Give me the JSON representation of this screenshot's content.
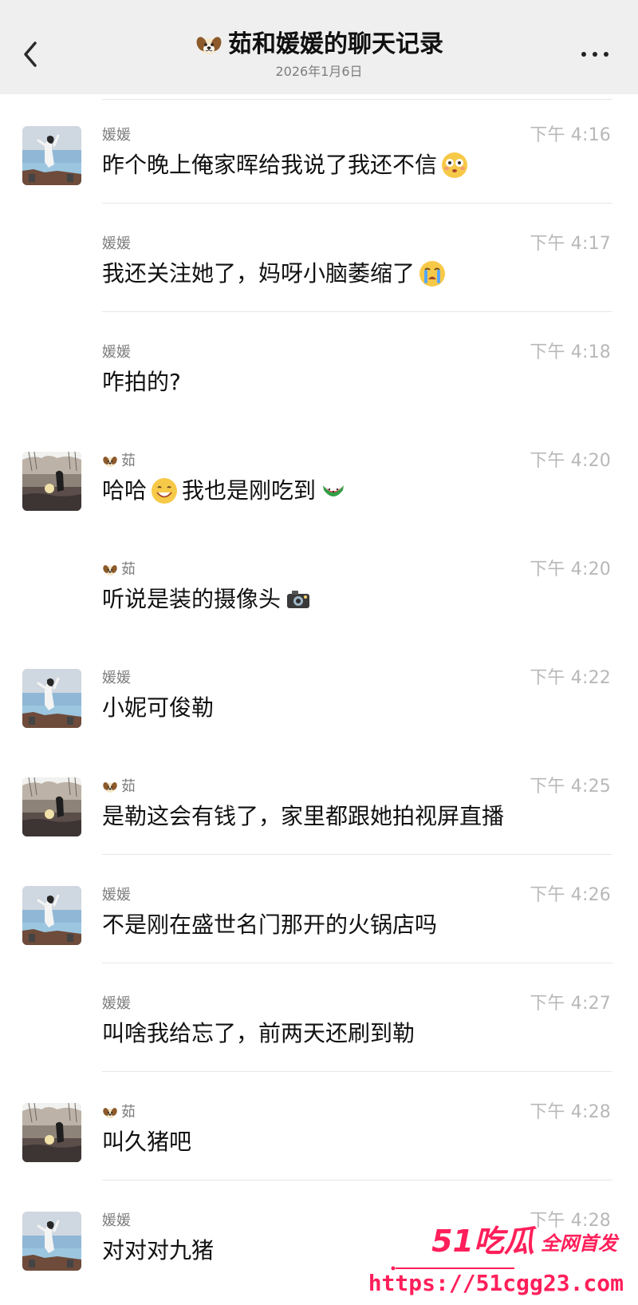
{
  "header": {
    "title": "茹和媛媛的聊天记录",
    "date": "2026年1月6日",
    "title_icon": "dog-face-icon",
    "back_icon": "chevron-left-icon",
    "more_icon": "more-horizontal-icon"
  },
  "messages": [
    {
      "sender": "媛媛",
      "time": "下午 4:16",
      "text": "昨个晚上俺家晖给我说了我还不信",
      "emoji": "flushed-face-icon",
      "show_avatar": true,
      "avatar_style": "girl"
    },
    {
      "sender": "媛媛",
      "time": "下午 4:17",
      "text": "我还关注她了，妈呀小脑萎缩了",
      "emoji": "crying-face-icon",
      "show_avatar": false,
      "avatar_style": "girl"
    },
    {
      "sender": "媛媛",
      "time": "下午 4:18",
      "text": "咋拍的?",
      "emoji": "",
      "show_avatar": false,
      "avatar_style": "girl"
    },
    {
      "sender": "茹",
      "time": "下午 4:20",
      "text_before": "哈哈",
      "text_after": "我也是刚吃到",
      "emoji_before": "grinning-face-icon",
      "emoji_after": "watermelon-icon",
      "show_avatar": true,
      "avatar_style": "sunset"
    },
    {
      "sender": "茹",
      "time": "下午 4:20",
      "text": "听说是装的摄像头",
      "emoji": "camera-icon",
      "show_avatar": false,
      "avatar_style": "sunset"
    },
    {
      "sender": "媛媛",
      "time": "下午 4:22",
      "text": "小妮可俊勒",
      "emoji": "",
      "show_avatar": true,
      "avatar_style": "girl"
    },
    {
      "sender": "茹",
      "time": "下午 4:25",
      "text": "是勒这会有钱了，家里都跟她拍视屏直播",
      "emoji": "",
      "show_avatar": true,
      "avatar_style": "sunset"
    },
    {
      "sender": "媛媛",
      "time": "下午 4:26",
      "text": "不是刚在盛世名门那开的火锅店吗",
      "emoji": "",
      "show_avatar": true,
      "avatar_style": "girl"
    },
    {
      "sender": "媛媛",
      "time": "下午 4:27",
      "text": "叫啥我给忘了，前两天还刷到勒",
      "emoji": "",
      "show_avatar": false,
      "avatar_style": "girl"
    },
    {
      "sender": "茹",
      "time": "下午 4:28",
      "text": "叫久猪吧",
      "emoji": "",
      "show_avatar": true,
      "avatar_style": "sunset"
    },
    {
      "sender": "媛媛",
      "time": "下午 4:28",
      "text": "对对对九猪",
      "emoji": "",
      "show_avatar": true,
      "avatar_style": "girl"
    }
  ],
  "watermark": {
    "brand": "51吃瓜",
    "tagline": "全网首发",
    "url": "https://51cgg23.com"
  }
}
